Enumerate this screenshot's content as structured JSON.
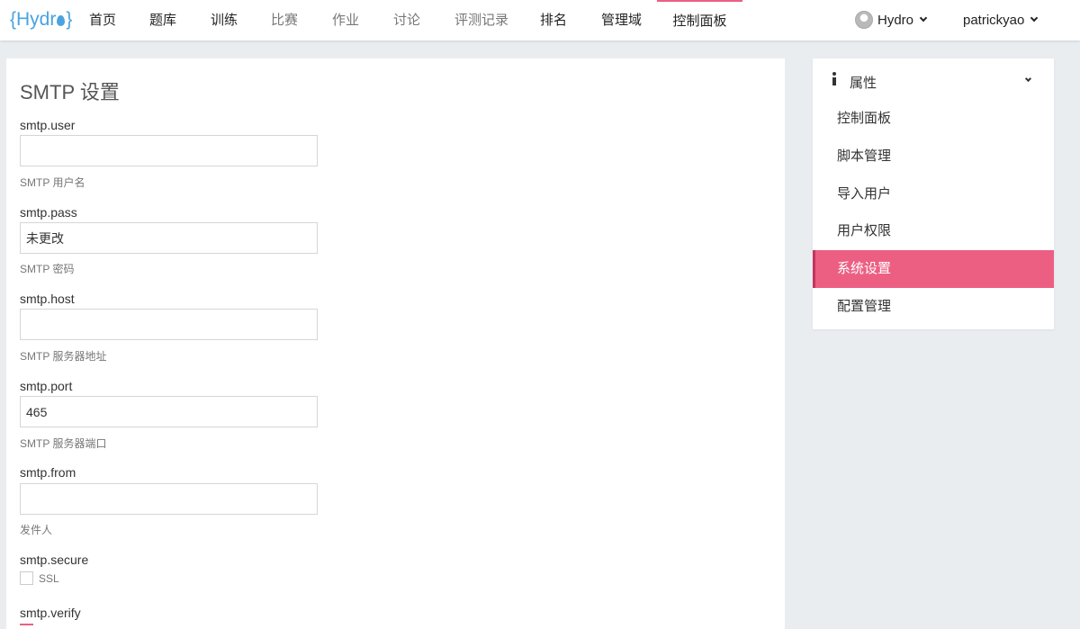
{
  "nav": {
    "logo": "{Hydro}",
    "logo_parts": [
      "{Hydr",
      "}"
    ],
    "items": [
      {
        "label": "首页"
      },
      {
        "label": "题库"
      },
      {
        "label": "训练"
      },
      {
        "label": "比赛"
      },
      {
        "label": "作业"
      },
      {
        "label": "讨论"
      },
      {
        "label": "评测记录"
      },
      {
        "label": "排名"
      },
      {
        "label": "管理域"
      },
      {
        "label": "控制面板"
      }
    ],
    "domain_menu": "Hydro",
    "user_menu": "patrickyao"
  },
  "main": {
    "title": "SMTP 设置",
    "fields": [
      {
        "label": "smtp.user",
        "value": "",
        "help": "SMTP 用户名"
      },
      {
        "label": "smtp.pass",
        "value": "未更改",
        "help": "SMTP 密码"
      },
      {
        "label": "smtp.host",
        "value": "",
        "help": "SMTP 服务器地址"
      },
      {
        "label": "smtp.port",
        "value": "465",
        "help": "SMTP 服务器端口"
      },
      {
        "label": "smtp.from",
        "value": "",
        "help": "发件人"
      }
    ],
    "secure": {
      "label": "smtp.secure",
      "option": "SSL",
      "checked": false
    },
    "verify": {
      "label": "smtp.verify"
    }
  },
  "sidebar": {
    "header": "属性",
    "header_icon": "info-icon",
    "items": [
      {
        "label": "控制面板",
        "active": false
      },
      {
        "label": "脚本管理",
        "active": false
      },
      {
        "label": "导入用户",
        "active": false
      },
      {
        "label": "用户权限",
        "active": false
      },
      {
        "label": "系统设置",
        "active": true
      },
      {
        "label": "配置管理",
        "active": false
      }
    ]
  },
  "colors": {
    "accent": "#ec5f83",
    "logo": "#4aa3df",
    "background": "#e9edf0"
  }
}
